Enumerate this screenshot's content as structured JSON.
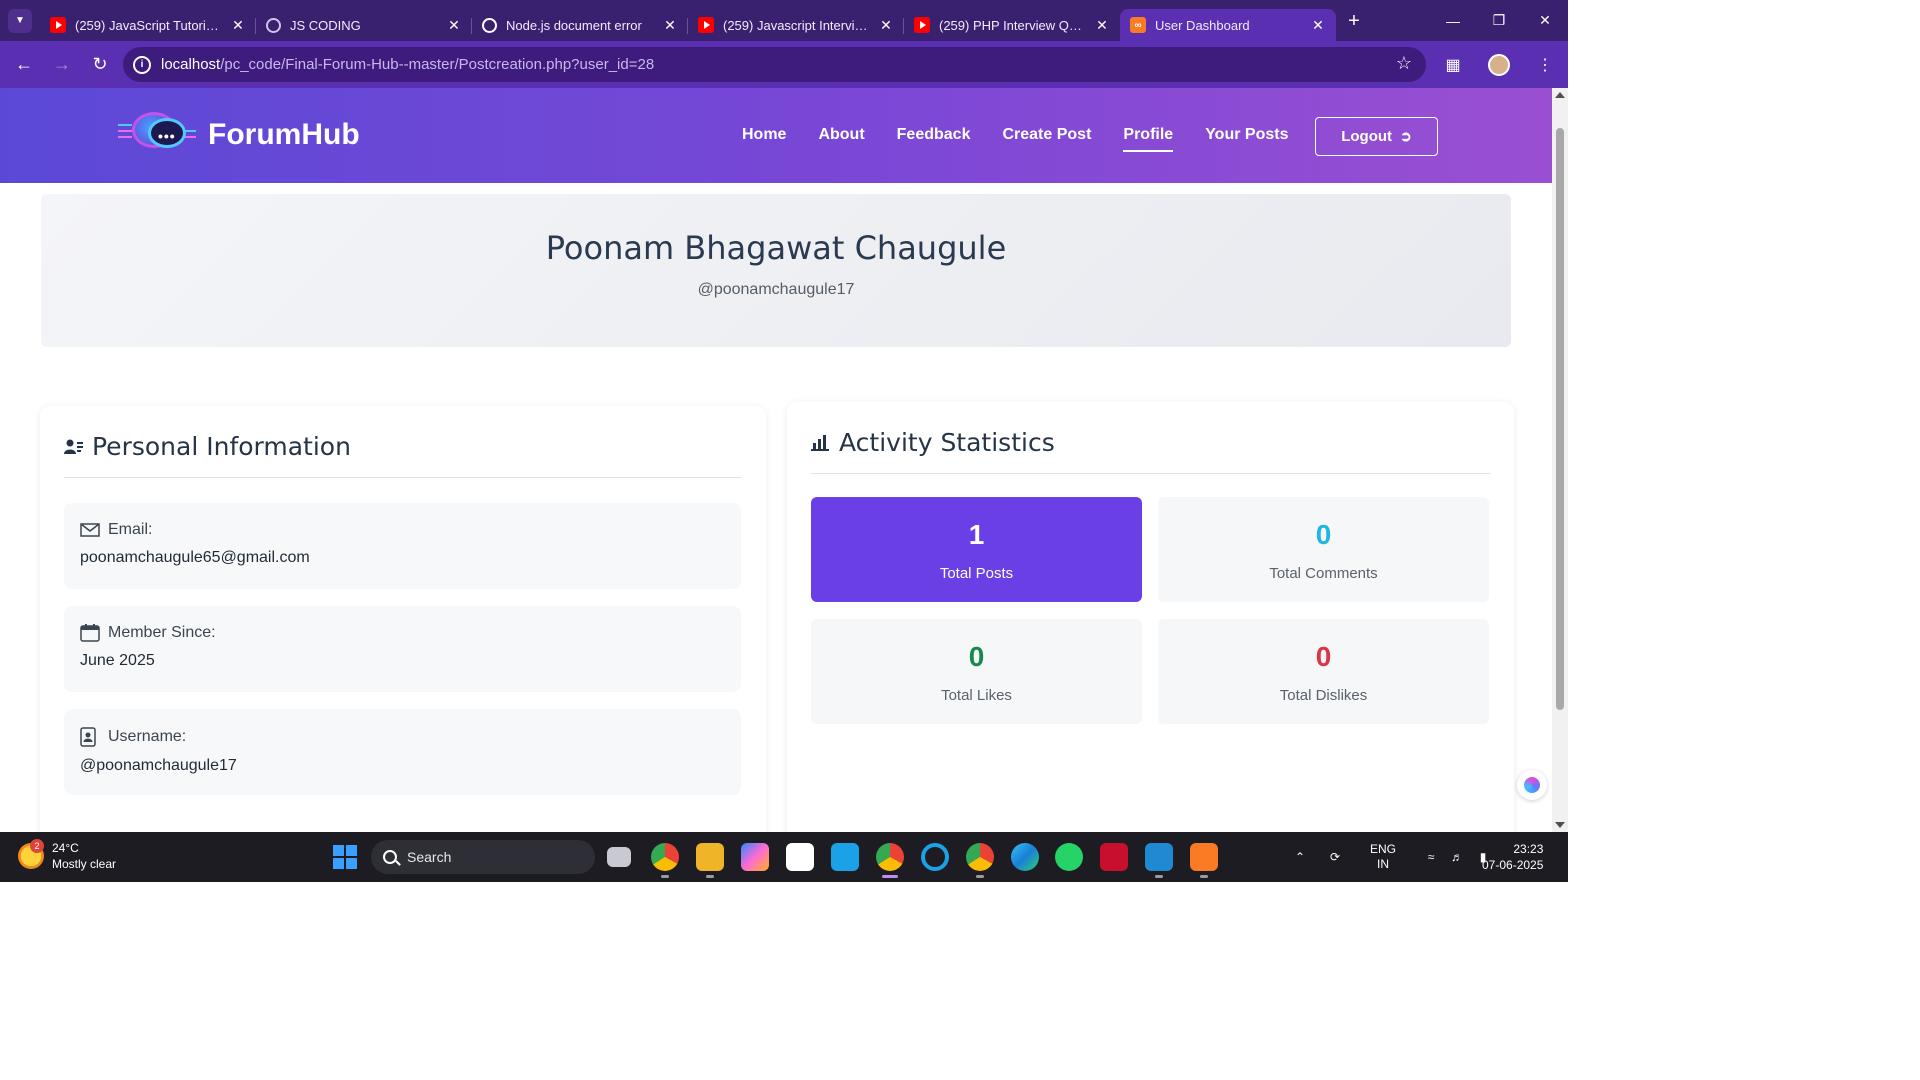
{
  "browser": {
    "tabs": [
      {
        "title": "(259) JavaScript Tutorial In",
        "icon": "youtube-icon",
        "active": false
      },
      {
        "title": "JS CODING",
        "icon": "globe-icon",
        "active": false
      },
      {
        "title": "Node.js document error",
        "icon": "chatgpt-icon",
        "active": false
      },
      {
        "title": "(259) Javascript Interview C",
        "icon": "youtube-icon",
        "active": false
      },
      {
        "title": "(259) PHP Interview Questi",
        "icon": "youtube-icon",
        "active": false
      },
      {
        "title": "User Dashboard",
        "icon": "xampp-icon",
        "active": true
      }
    ],
    "url_host": "localhost",
    "url_path": "/pc_code/Final-Forum-Hub--master/Postcreation.php?user_id=28"
  },
  "navbar": {
    "brand": "ForumHub",
    "links": [
      "Home",
      "About",
      "Feedback",
      "Create Post",
      "Profile",
      "Your Posts"
    ],
    "active_link": "Profile",
    "logout_label": "Logout"
  },
  "profile": {
    "full_name": "Poonam Bhagawat Chaugule",
    "handle": "@poonamchaugule17"
  },
  "personal_info": {
    "title": "Personal Information",
    "email_label": "Email:",
    "email_value": "poonamchaugule65@gmail.com",
    "member_since_label": "Member Since:",
    "member_since_value": "June 2025",
    "username_label": "Username:",
    "username_value": "@poonamchaugule17"
  },
  "activity": {
    "title": "Activity Statistics",
    "stats": [
      {
        "value": "1",
        "label": "Total Posts",
        "color": "#ffffff"
      },
      {
        "value": "0",
        "label": "Total Comments",
        "color": "#1fb6e4"
      },
      {
        "value": "0",
        "label": "Total Likes",
        "color": "#178a4b"
      },
      {
        "value": "0",
        "label": "Total Dislikes",
        "color": "#dc3545"
      }
    ]
  },
  "taskbar": {
    "temperature": "24°C",
    "weather": "Mostly clear",
    "weather_badge": "2",
    "search_placeholder": "Search",
    "language_line1": "ENG",
    "language_line2": "IN",
    "time": "23:23",
    "date": "07-06-2025"
  },
  "colors": {
    "navbar_gradient_start": "#5b49d6",
    "navbar_gradient_end": "#9a4fd2",
    "primary_stat": "#6a3fe6",
    "browser_frame": "#5b2fb1"
  }
}
